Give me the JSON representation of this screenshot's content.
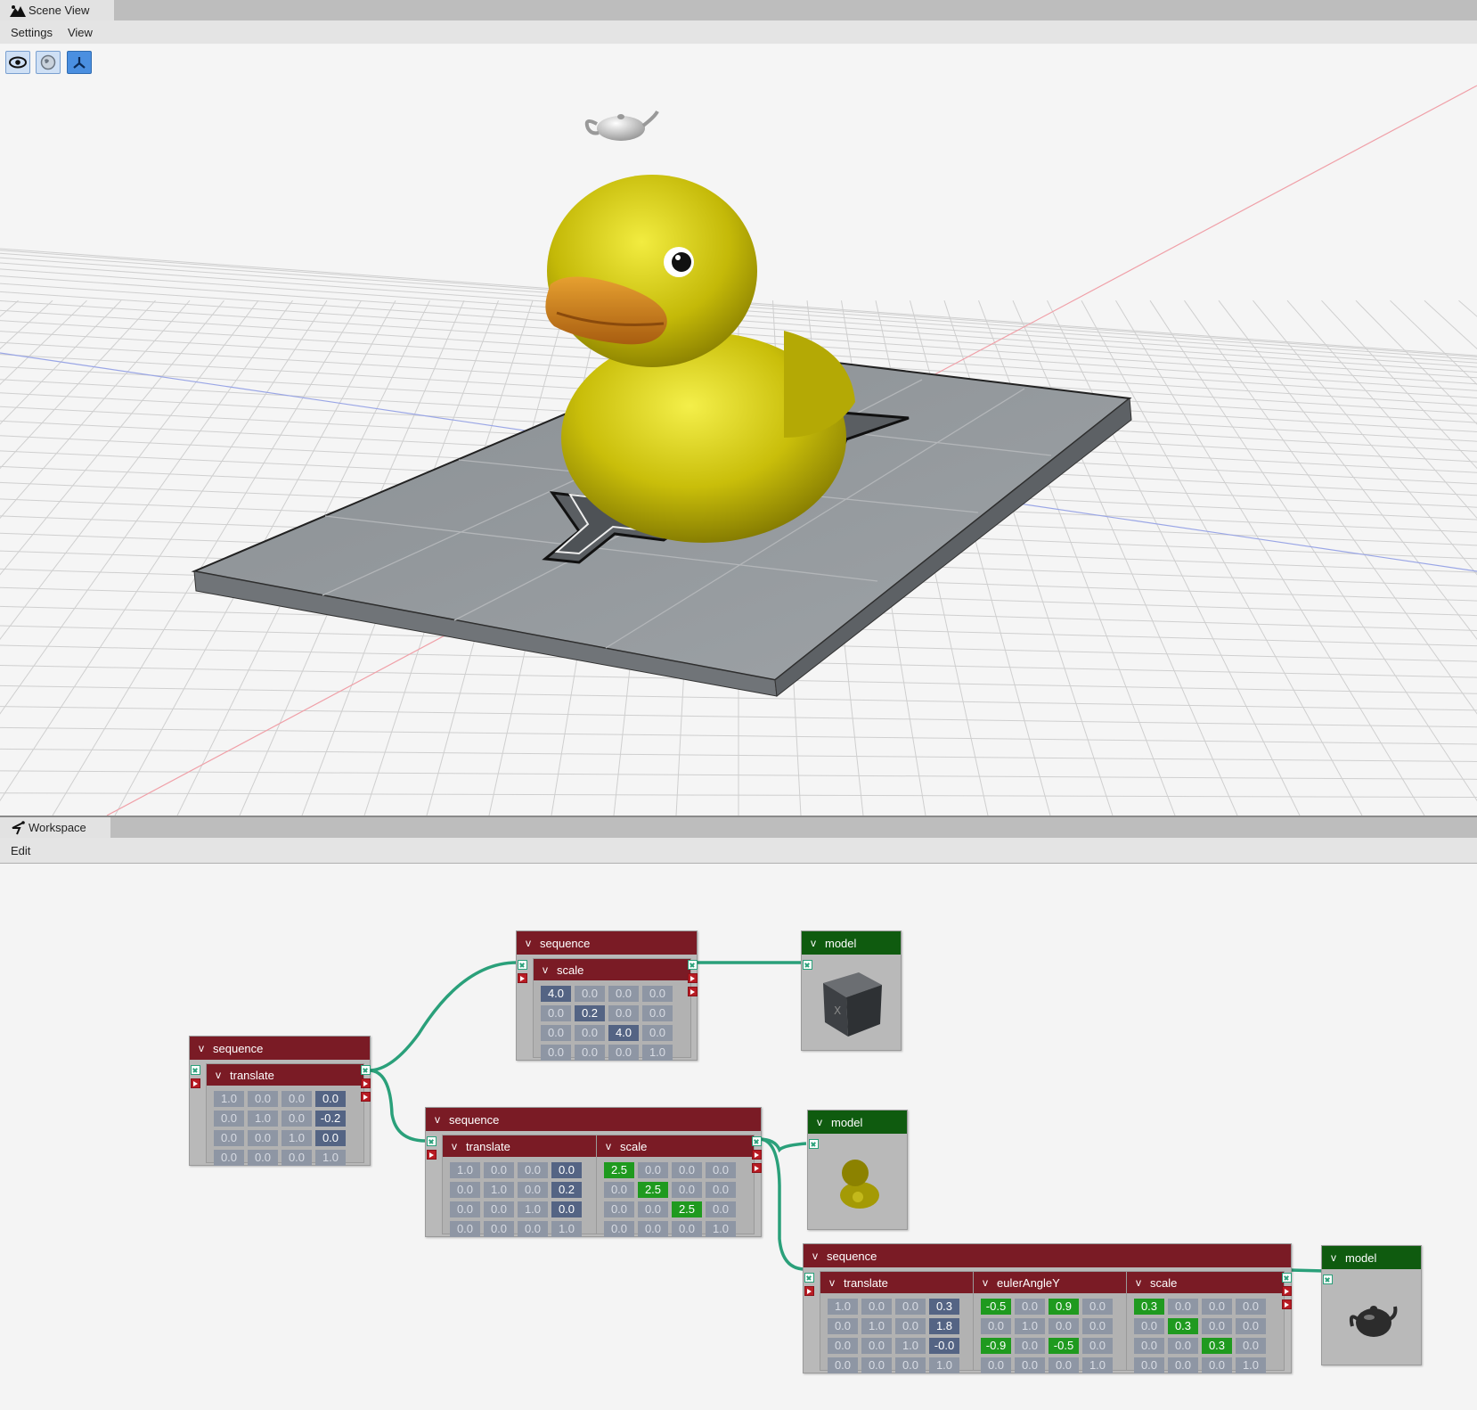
{
  "scene_view": {
    "tab_label": "Scene View",
    "menu": [
      "Settings",
      "View"
    ],
    "tools": [
      {
        "name": "eye-icon",
        "active": false
      },
      {
        "name": "globe-icon",
        "active": false
      },
      {
        "name": "axes-icon",
        "active": true
      }
    ]
  },
  "workspace": {
    "tab_label": "Workspace",
    "menu": [
      "Edit"
    ],
    "nodes": {
      "seq_root": {
        "title": "sequence",
        "child": {
          "title": "translate",
          "matrix": [
            [
              "1.0",
              "0.0",
              "0.0",
              "0.0"
            ],
            [
              "0.0",
              "1.0",
              "0.0",
              "-0.2"
            ],
            [
              "0.0",
              "0.0",
              "1.0",
              "0.0"
            ],
            [
              "0.0",
              "0.0",
              "0.0",
              "1.0"
            ]
          ]
        }
      },
      "seq_box": {
        "title": "sequence",
        "child": {
          "title": "scale",
          "matrix": [
            [
              "4.0",
              "0.0",
              "0.0",
              "0.0"
            ],
            [
              "0.0",
              "0.2",
              "0.0",
              "0.0"
            ],
            [
              "0.0",
              "0.0",
              "4.0",
              "0.0"
            ],
            [
              "0.0",
              "0.0",
              "0.0",
              "1.0"
            ]
          ]
        }
      },
      "model_box": {
        "title": "model",
        "thumb": "crate-thumbnail"
      },
      "seq_duck": {
        "title": "sequence",
        "translate": {
          "title": "translate",
          "matrix": [
            [
              "1.0",
              "0.0",
              "0.0",
              "0.0"
            ],
            [
              "0.0",
              "1.0",
              "0.0",
              "0.2"
            ],
            [
              "0.0",
              "0.0",
              "1.0",
              "0.0"
            ],
            [
              "0.0",
              "0.0",
              "0.0",
              "1.0"
            ]
          ]
        },
        "scale": {
          "title": "scale",
          "matrix": [
            [
              "2.5",
              "0.0",
              "0.0",
              "0.0"
            ],
            [
              "0.0",
              "2.5",
              "0.0",
              "0.0"
            ],
            [
              "0.0",
              "0.0",
              "2.5",
              "0.0"
            ],
            [
              "0.0",
              "0.0",
              "0.0",
              "1.0"
            ]
          ]
        }
      },
      "model_duck": {
        "title": "model",
        "thumb": "duck-thumbnail"
      },
      "seq_teapot": {
        "title": "sequence",
        "translate": {
          "title": "translate",
          "matrix": [
            [
              "1.0",
              "0.0",
              "0.0",
              "0.3"
            ],
            [
              "0.0",
              "1.0",
              "0.0",
              "1.8"
            ],
            [
              "0.0",
              "0.0",
              "1.0",
              "-0.0"
            ],
            [
              "0.0",
              "0.0",
              "0.0",
              "1.0"
            ]
          ]
        },
        "euler": {
          "title": "eulerAngleY",
          "matrix": [
            [
              "-0.5",
              "0.0",
              "0.9",
              "0.0"
            ],
            [
              "0.0",
              "1.0",
              "0.0",
              "0.0"
            ],
            [
              "-0.9",
              "0.0",
              "-0.5",
              "0.0"
            ],
            [
              "0.0",
              "0.0",
              "0.0",
              "1.0"
            ]
          ]
        },
        "scale": {
          "title": "scale",
          "matrix": [
            [
              "0.3",
              "0.0",
              "0.0",
              "0.0"
            ],
            [
              "0.0",
              "0.3",
              "0.0",
              "0.0"
            ],
            [
              "0.0",
              "0.0",
              "0.3",
              "0.0"
            ],
            [
              "0.0",
              "0.0",
              "0.0",
              "1.0"
            ]
          ]
        }
      },
      "model_teapot": {
        "title": "model",
        "thumb": "teapot-thumbnail"
      }
    }
  },
  "colors": {
    "sequence_header": "#7a1b25",
    "model_header": "#0f5b0f",
    "wire": "#2aa07a",
    "highlight_cell": "#546484",
    "green_cell": "#1f9a1f"
  }
}
